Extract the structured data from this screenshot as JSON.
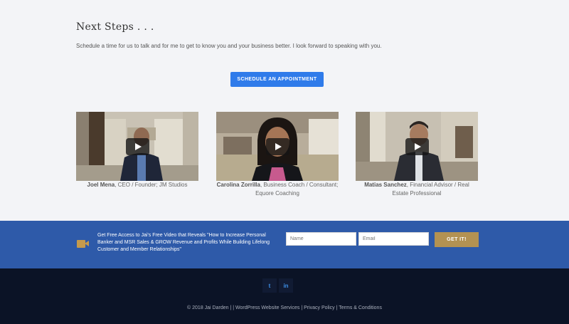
{
  "next_steps": {
    "heading": "Next Steps . . .",
    "intro": "Schedule a time for us to talk and for me to get to know you and your business better. I look forward to speaking with you.",
    "cta_label": "SCHEDULE AN APPOINTMENT"
  },
  "videos": [
    {
      "name": "Joel Mena",
      "role": ", CEO / Founder; JM Studios"
    },
    {
      "name": "Carolina Zorrilla",
      "role": ", Business Coach / Consultant; Equore Coaching"
    },
    {
      "name": "Matias Sanchez",
      "role": ", Financial Advisor / Real Estate Professional"
    }
  ],
  "optin": {
    "text": "Get Free Access to Jai's Free Video that Reveals \"How to Increase Personal Banker and MSR Sales & GROW Revenue and Profits While Building Lifelong Customer and Member Relationships\"",
    "name_placeholder": "Name",
    "email_placeholder": "Email",
    "button_label": "GET IT!",
    "icon": "video-camera-icon"
  },
  "footer": {
    "social": [
      {
        "icon": "twitter-icon",
        "glyph": "t"
      },
      {
        "icon": "linkedin-icon",
        "glyph": "in"
      }
    ],
    "copyright": "© 2018 Jai Darden |",
    "sep1": " | ",
    "link_wordpress": "WordPress Website Services",
    "sep2": " | ",
    "link_privacy": "Privacy Policy",
    "sep3": " | ",
    "link_terms": "Terms & Conditions"
  },
  "colors": {
    "accent_blue": "#2f7bea",
    "optin_bg": "#2e5aa9",
    "gold": "#b39252",
    "footer_bg": "#0b1326"
  }
}
